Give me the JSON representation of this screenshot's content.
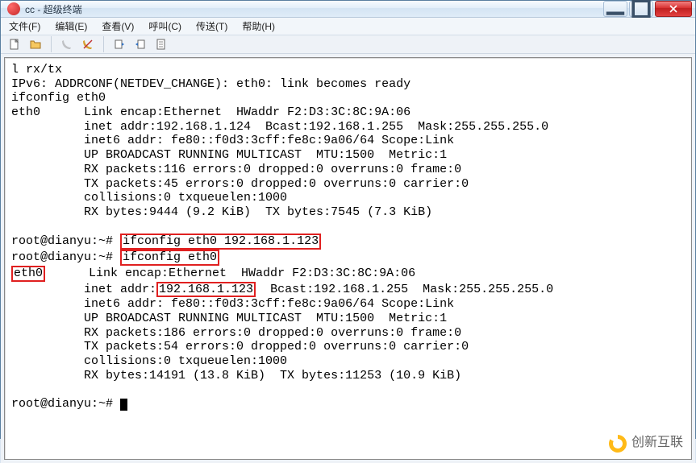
{
  "window": {
    "title": "cc - 超级终端"
  },
  "menu": {
    "file": "文件(F)",
    "edit": "编辑(E)",
    "view": "查看(V)",
    "call": "呼叫(C)",
    "transfer": "传送(T)",
    "help": "帮助(H)"
  },
  "toolbar_icons": {
    "new": "new-file-icon",
    "open": "open-folder-icon",
    "connect": "phone-connect-icon",
    "disconnect": "phone-disconnect-icon",
    "send": "send-file-icon",
    "recv": "receive-file-icon",
    "props": "properties-icon"
  },
  "terminal": {
    "l1": "l rx/tx",
    "l2": "IPv6: ADDRCONF(NETDEV_CHANGE): eth0: link becomes ready",
    "l3": "ifconfig eth0",
    "l4": "eth0      Link encap:Ethernet  HWaddr F2:D3:3C:8C:9A:06",
    "l5": "          inet addr:192.168.1.124  Bcast:192.168.1.255  Mask:255.255.255.0",
    "l6": "          inet6 addr: fe80::f0d3:3cff:fe8c:9a06/64 Scope:Link",
    "l7": "          UP BROADCAST RUNNING MULTICAST  MTU:1500  Metric:1",
    "l8": "          RX packets:116 errors:0 dropped:0 overruns:0 frame:0",
    "l9": "          TX packets:45 errors:0 dropped:0 overruns:0 carrier:0",
    "l10": "          collisions:0 txqueuelen:1000",
    "l11": "          RX bytes:9444 (9.2 KiB)  TX bytes:7545 (7.3 KiB)",
    "blank1": "",
    "p1_prefix": "root@dianyu:~# ",
    "p1_cmd": "ifconfig eth0 192.168.1.123",
    "p2_prefix": "root@dianyu:~# ",
    "p2_cmd": "ifconfig eth0",
    "r1_iface": "eth0",
    "r1_rest": "      Link encap:Ethernet  HWaddr F2:D3:3C:8C:9A:06",
    "r2_prefix": "          inet addr:",
    "r2_ip": "192.168.1.123",
    "r2_rest": "  Bcast:192.168.1.255  Mask:255.255.255.0",
    "r3": "          inet6 addr: fe80::f0d3:3cff:fe8c:9a06/64 Scope:Link",
    "r4": "          UP BROADCAST RUNNING MULTICAST  MTU:1500  Metric:1",
    "r5": "          RX packets:186 errors:0 dropped:0 overruns:0 frame:0",
    "r6": "          TX packets:54 errors:0 dropped:0 overruns:0 carrier:0",
    "r7": "          collisions:0 txqueuelen:1000",
    "r8": "          RX bytes:14191 (13.8 KiB)  TX bytes:11253 (10.9 KiB)",
    "blank2": "",
    "p3": "root@dianyu:~# "
  },
  "watermark": {
    "text": "创新互联"
  }
}
